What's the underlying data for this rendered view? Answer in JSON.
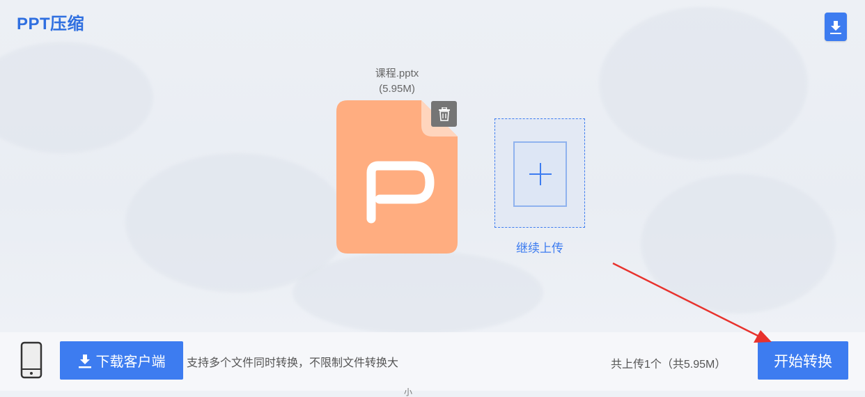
{
  "header": {
    "title": "PPT压缩",
    "download_icon": "download-icon"
  },
  "file": {
    "name": "课程.pptx",
    "size": "(5.95M)",
    "icon": "ppt-file-icon",
    "delete_icon": "trash-icon",
    "color": "#ffad80"
  },
  "add_more": {
    "label": "继续上传",
    "icon": "plus-icon"
  },
  "footer": {
    "phone_icon": "phone-icon",
    "download_client_label": "下载客户端",
    "support_text": "支持多个文件同时转换，不限制文件转换大",
    "summary_text": "共上传1个（共5.95M）",
    "start_label": "开始转换",
    "stray_glyph": "小"
  },
  "colors": {
    "accent": "#3d7cf0",
    "annotation_arrow": "#e8322d"
  }
}
